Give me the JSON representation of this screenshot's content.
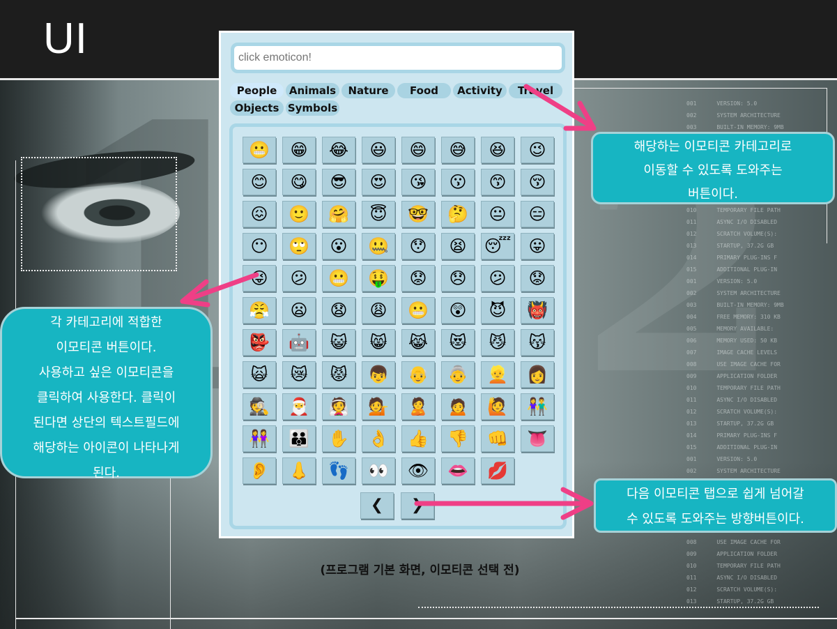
{
  "slide_title": "UI",
  "app": {
    "input_placeholder": "click emoticon!",
    "tabs": [
      {
        "label": "People",
        "active": true
      },
      {
        "label": "Animals",
        "active": false
      },
      {
        "label": "Nature",
        "active": false
      },
      {
        "label": "Food",
        "active": false
      },
      {
        "label": "Activity",
        "active": false
      },
      {
        "label": "Travel",
        "active": false
      },
      {
        "label": "Objects",
        "active": false
      },
      {
        "label": "Symbols",
        "active": false
      }
    ],
    "emoji_rows": [
      [
        "😬",
        "😁",
        "😂",
        "😃",
        "😄",
        "😅",
        "😆",
        "😉"
      ],
      [
        "😊",
        "😋",
        "😎",
        "😍",
        "😘",
        "😗",
        "😙",
        "😚"
      ],
      [
        "😖",
        "🙂",
        "🤗",
        "😇",
        "🤓",
        "🤔",
        "😐",
        "😑"
      ],
      [
        "😶",
        "🙄",
        "😮",
        "🤐",
        "😯",
        "😫",
        "😴",
        "😛"
      ],
      [
        "😜",
        "😕",
        "😬",
        "🤑",
        "😟",
        "😞",
        "😕",
        "😟"
      ],
      [
        "😤",
        "😦",
        "😧",
        "😩",
        "😬",
        "😲",
        "😈",
        "👹"
      ],
      [
        "👺",
        "🤖",
        "😺",
        "😸",
        "😹",
        "😻",
        "😼",
        "😽"
      ],
      [
        "🙀",
        "😿",
        "😾",
        "👦",
        "👴",
        "👵",
        "👱",
        "👩"
      ],
      [
        "🕵",
        "🎅",
        "👰",
        "💁",
        "🙎",
        "🙍",
        "🙋",
        "👫"
      ],
      [
        "👭",
        "👪",
        "✋",
        "👌",
        "👍",
        "👎",
        "👊",
        "👅"
      ],
      [
        "👂",
        "👃",
        "👣",
        "👀",
        "👁",
        "👄",
        "💋"
      ]
    ],
    "nav": {
      "prev": "❮",
      "next": "❯"
    }
  },
  "callouts": {
    "tabs_note": [
      "해당하는 이모티콘 카테고리로",
      "이동할 수 있도록 도와주는",
      "버튼이다."
    ],
    "grid_note": [
      "각 카테고리에 적합한",
      "이모티콘 버튼이다.",
      "사용하고 싶은 이모티콘을",
      "클릭하여 사용한다. 클릭이",
      "된다면 상단의 텍스트필드에",
      "해당하는 아이콘이 나타나게",
      "된다."
    ],
    "nav_note": [
      "다음 이모티콘 탭으로 쉽게 넘어갈",
      "수 있도록 도와주는 방향버튼이다."
    ]
  },
  "caption": "(프로그램 기본 화면, 이모티콘 선택 전)",
  "colors": {
    "callout_bg": "#17b5c2",
    "arrow": "#ef3f86",
    "app_bg": "#cde6f0",
    "button_bg": "#aed0dc"
  }
}
